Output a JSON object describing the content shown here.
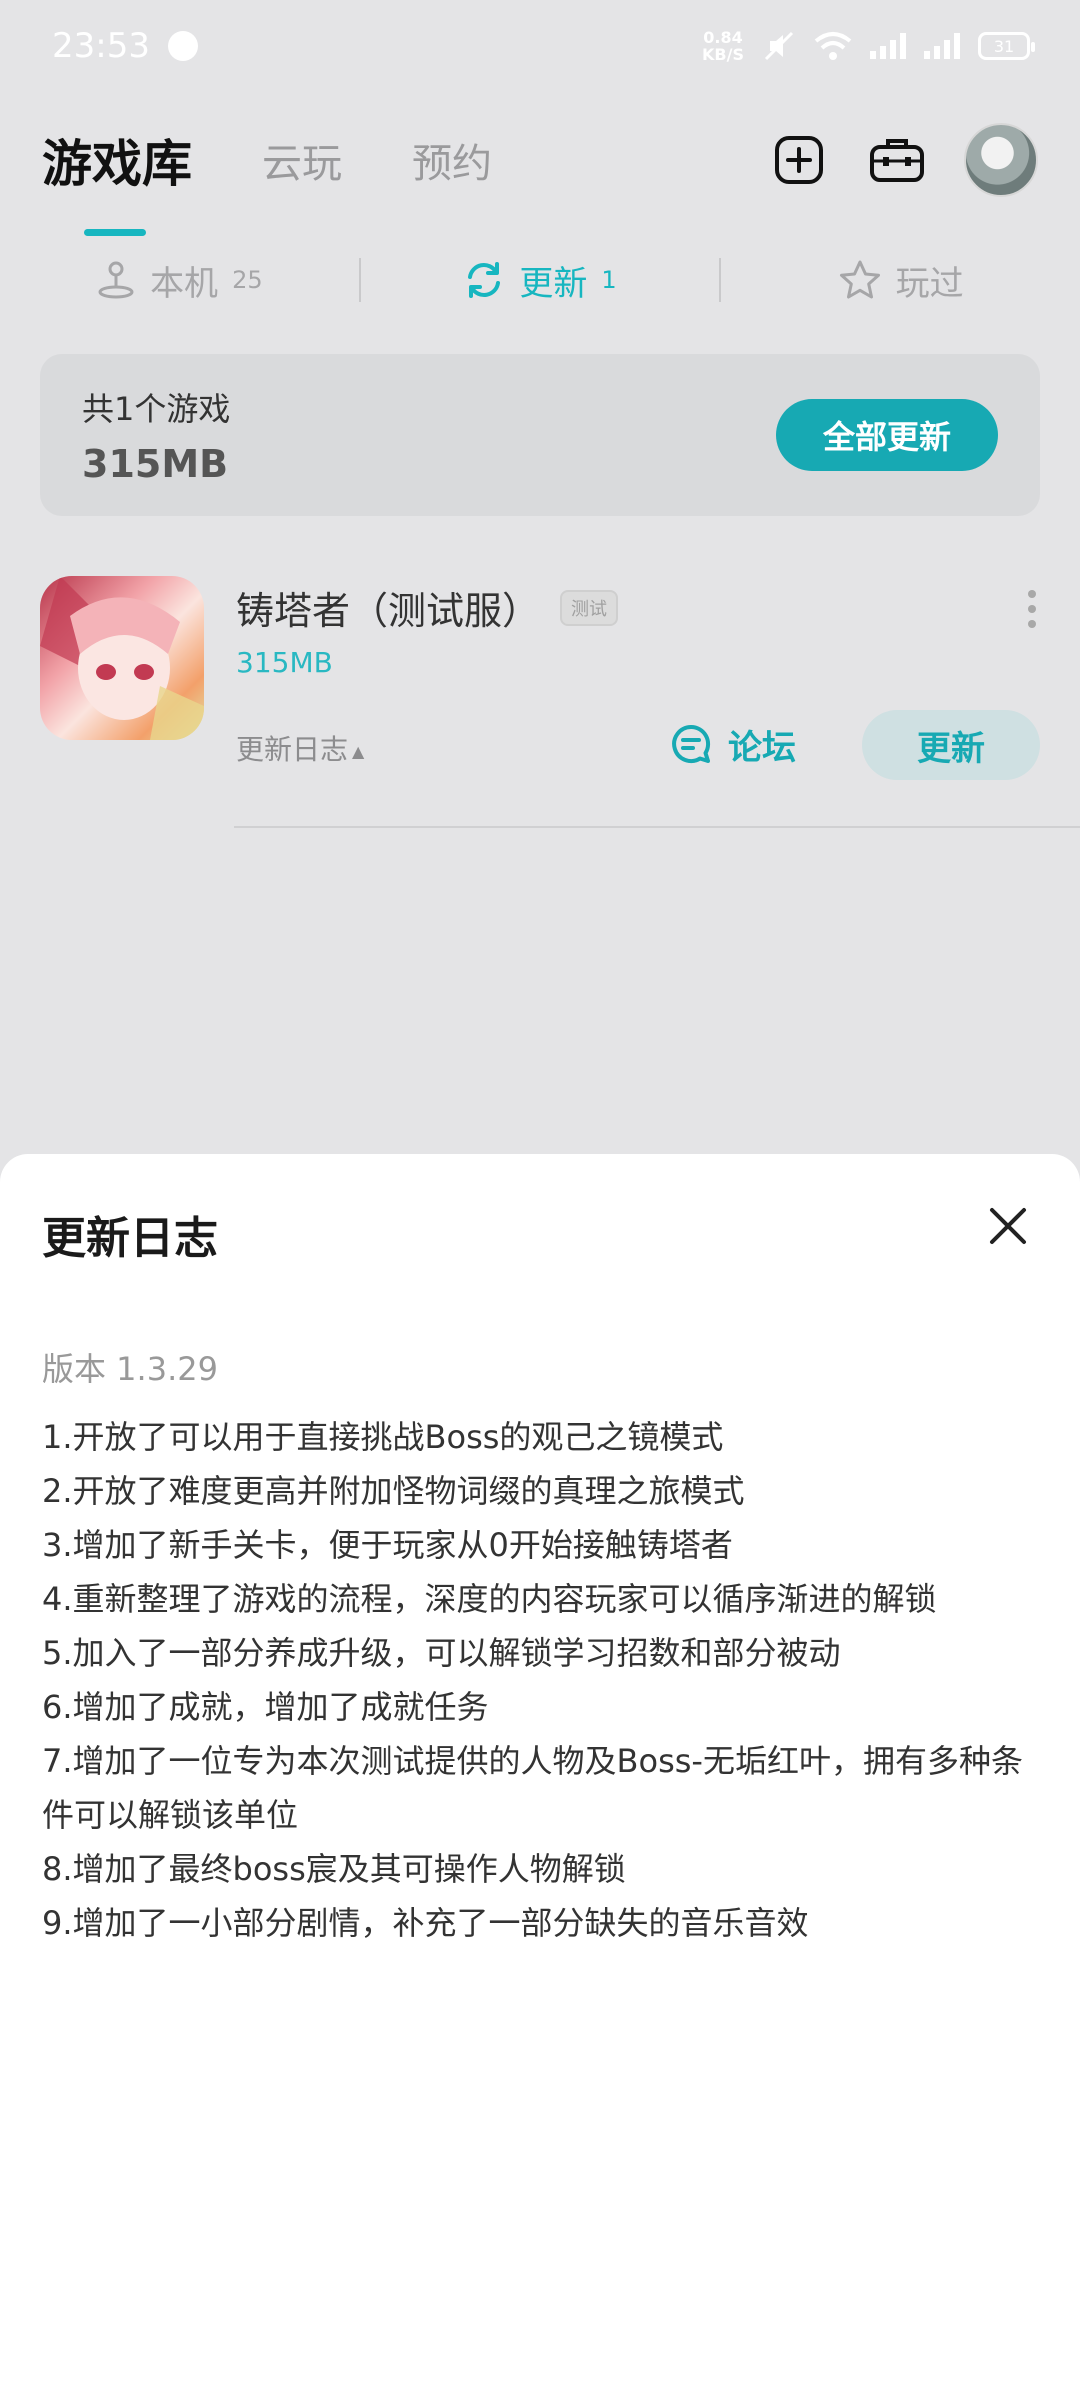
{
  "status_bar": {
    "time": "23:53",
    "net_speed_value": "0.84",
    "net_speed_unit": "KB/S",
    "battery": "31"
  },
  "top_nav": {
    "tabs": [
      "游戏库",
      "云玩",
      "预约"
    ],
    "active_tab": "游戏库"
  },
  "sub_tabs": [
    {
      "label": "本机",
      "count": "25"
    },
    {
      "label": "更新",
      "count": "1"
    },
    {
      "label": "玩过",
      "count": ""
    }
  ],
  "summary": {
    "count_text": "共1个游戏",
    "total_size": "315MB",
    "update_all_label": "全部更新"
  },
  "game": {
    "name": "铸塔者（测试服）",
    "badge": "测试",
    "size": "315MB",
    "changelog_label": "更新日志",
    "forum_label": "论坛",
    "update_label": "更新"
  },
  "sheet": {
    "title": "更新日志",
    "version": "版本 1.3.29",
    "items": [
      "1.开放了可以用于直接挑战Boss的观己之镜模式",
      "2.开放了难度更高并附加怪物词缀的真理之旅模式",
      "3.增加了新手关卡，便于玩家从0开始接触铸塔者",
      "4.重新整理了游戏的流程，深度的内容玩家可以循序渐进的解锁",
      "5.加入了一部分养成升级，可以解锁学习招数和部分被动",
      "6.增加了成就，增加了成就任务",
      "7.增加了一位专为本次测试提供的人物及Boss-无垢红叶，拥有多种条件可以解锁该单位",
      "8.增加了最终boss宸及其可操作人物解锁",
      "9.增加了一小部分剧情，补充了一部分缺失的音乐音效"
    ]
  },
  "colors": {
    "accent": "#17b6c0",
    "background": "#e4e4e6",
    "sheet": "#ffffff"
  }
}
